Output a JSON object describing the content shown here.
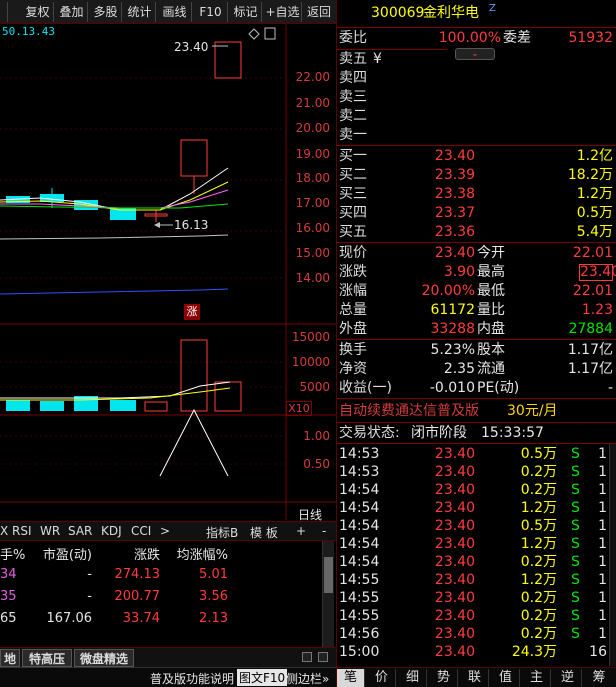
{
  "toolbar": {
    "buttons": [
      "复权",
      "叠加",
      "多股",
      "统计",
      "画线",
      "F10",
      "标记",
      "+自选",
      "返回"
    ]
  },
  "chart": {
    "top_readout": "50.13.43",
    "price_axis": [
      "22.00",
      "21.00",
      "20.00",
      "19.00",
      "18.00",
      "17.00",
      "16.00",
      "15.00",
      "14.00"
    ],
    "high_label": "23.40",
    "low_label": "16.13",
    "limit_up_badge": "涨",
    "volume_axis": [
      "15000",
      "10000",
      "5000"
    ],
    "volume_multiplier": "X10",
    "indicator_axis": [
      "1.00",
      "0.50"
    ],
    "period_label": "日线"
  },
  "indicator_tabs": [
    "X",
    "RSI",
    "WR",
    "SAR",
    "KDJ",
    "CCI",
    ">",
    "指标B",
    "模 板",
    "+",
    "-"
  ],
  "bottom_table": {
    "headers": [
      "手%",
      "市盈(动)",
      "涨跌",
      "均涨幅%"
    ],
    "rows": [
      {
        "c0": "34",
        "c1": "-",
        "c2": "274.13",
        "c3": "5.01"
      },
      {
        "c0": "35",
        "c1": "-",
        "c2": "200.77",
        "c3": "3.56"
      },
      {
        "c0": "65",
        "c1": "167.06",
        "c2": "33.74",
        "c3": "2.13"
      }
    ]
  },
  "bottom_tabs": [
    "地",
    "特高压",
    "微盘精选"
  ],
  "status_bar": {
    "link1": "普及版功能说明",
    "link2": "图文F10",
    "link3": "侧边栏»"
  },
  "quote": {
    "code": "300069",
    "name": "金利华电",
    "badge": "Z",
    "weibi_label": "委比",
    "weibi_value": "100.00%",
    "weicha_label": "委差",
    "weicha_value": "51932",
    "sell": [
      {
        "label": "卖五",
        "mark": "¥",
        "price": "",
        "vol": ""
      },
      {
        "label": "卖四",
        "mark": "",
        "price": "",
        "vol": ""
      },
      {
        "label": "卖三",
        "mark": "",
        "price": "",
        "vol": ""
      },
      {
        "label": "卖二",
        "mark": "",
        "price": "",
        "vol": ""
      },
      {
        "label": "卖一",
        "mark": "",
        "price": "",
        "vol": ""
      }
    ],
    "buy": [
      {
        "label": "买一",
        "price": "23.40",
        "vol": "1.2亿"
      },
      {
        "label": "买二",
        "price": "23.39",
        "vol": "18.2万"
      },
      {
        "label": "买三",
        "price": "23.38",
        "vol": "1.2万"
      },
      {
        "label": "买四",
        "price": "23.37",
        "vol": "0.5万"
      },
      {
        "label": "买五",
        "price": "23.36",
        "vol": "5.4万"
      }
    ],
    "stats": [
      {
        "l1": "现价",
        "v1": "23.40",
        "l2": "今开",
        "v2": "22.01"
      },
      {
        "l1": "涨跌",
        "v1": "3.90",
        "l2": "最高",
        "v2": "23.40"
      },
      {
        "l1": "涨幅",
        "v1": "20.00%",
        "l2": "最低",
        "v2": "22.01"
      },
      {
        "l1": "总量",
        "v1": "61172",
        "l2": "量比",
        "v2": "1.23"
      },
      {
        "l1": "外盘",
        "v1": "33288",
        "l2": "内盘",
        "v2": "27884"
      }
    ],
    "stats2": [
      {
        "l1": "换手",
        "v1": "5.23%",
        "l2": "股本",
        "v2": "1.17亿"
      },
      {
        "l1": "净资",
        "v1": "2.35",
        "l2": "流通",
        "v2": "1.17亿"
      },
      {
        "l1": "收益(一)",
        "v1": "-0.010",
        "l2": "PE(动)",
        "v2": "-"
      }
    ],
    "promo_text": "自动续费通达信普及版",
    "promo_price": "30元/月",
    "trade_status_label": "交易状态:",
    "trade_status": "闭市阶段",
    "trade_time": "15:33:57"
  },
  "ticks": [
    {
      "t": "14:53",
      "p": "23.40",
      "v": "0.5万",
      "s": "S",
      "n": "1"
    },
    {
      "t": "14:53",
      "p": "23.40",
      "v": "0.2万",
      "s": "S",
      "n": "1"
    },
    {
      "t": "14:54",
      "p": "23.40",
      "v": "0.2万",
      "s": "S",
      "n": "1"
    },
    {
      "t": "14:54",
      "p": "23.40",
      "v": "1.2万",
      "s": "S",
      "n": "1"
    },
    {
      "t": "14:54",
      "p": "23.40",
      "v": "0.5万",
      "s": "S",
      "n": "1"
    },
    {
      "t": "14:54",
      "p": "23.40",
      "v": "1.2万",
      "s": "S",
      "n": "1"
    },
    {
      "t": "14:54",
      "p": "23.40",
      "v": "0.2万",
      "s": "S",
      "n": "1"
    },
    {
      "t": "14:55",
      "p": "23.40",
      "v": "1.2万",
      "s": "S",
      "n": "1"
    },
    {
      "t": "14:55",
      "p": "23.40",
      "v": "0.2万",
      "s": "S",
      "n": "1"
    },
    {
      "t": "14:55",
      "p": "23.40",
      "v": "0.2万",
      "s": "S",
      "n": "1"
    },
    {
      "t": "14:56",
      "p": "23.40",
      "v": "0.2万",
      "s": "S",
      "n": "1"
    },
    {
      "t": "15:00",
      "p": "23.40",
      "v": "24.3万",
      "s": "",
      "n": "16"
    }
  ],
  "right_tabs": [
    "笔",
    "价",
    "细",
    "势",
    "联",
    "值",
    "主",
    "逆",
    "筹"
  ]
}
